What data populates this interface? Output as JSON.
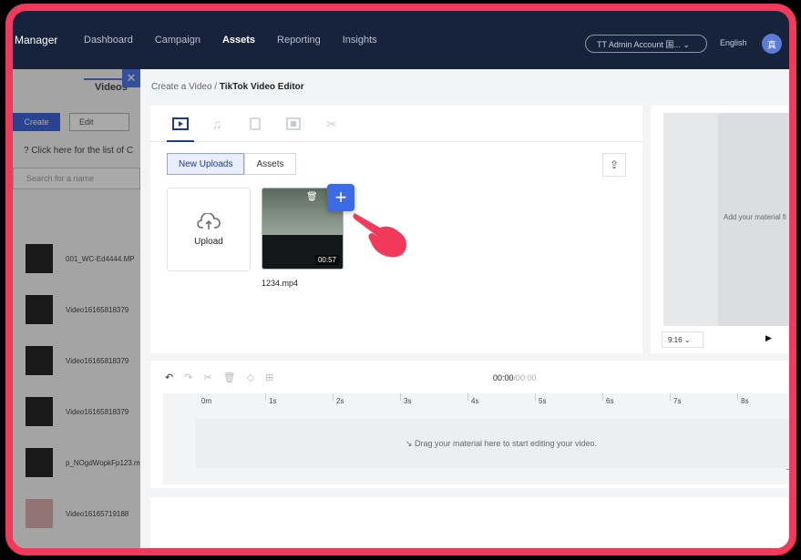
{
  "nav": {
    "brand": "Manager",
    "items": [
      "Dashboard",
      "Campaign",
      "Assets",
      "Reporting",
      "Insights"
    ],
    "active": "Assets",
    "account": "TT Admin Account 国... ⌄",
    "language": "English",
    "avatar": "真"
  },
  "left_panel": {
    "tab": "Videos",
    "close": "✕",
    "create": "Create",
    "edit": "Edit",
    "hint": "? Click here for the list of C",
    "search_placeholder": "Search for a name",
    "items": [
      {
        "name": "001_WC-Ed4444.MP"
      },
      {
        "name": "Video16165818379"
      },
      {
        "name": "Video16165818379"
      },
      {
        "name": "Video16165818379"
      },
      {
        "name": "p_NOgdWopkFp123.m"
      },
      {
        "name": "Video16165719188"
      }
    ]
  },
  "editor": {
    "breadcrumb_parent": "Create a Video",
    "breadcrumb_sep": " / ",
    "breadcrumb_current": "TikTok Video Editor",
    "tab_icons": [
      "video-icon",
      "music-icon",
      "text-icon",
      "sticker-icon",
      "effect-icon"
    ],
    "segments": [
      "New Uploads",
      "Assets"
    ],
    "active_segment": "New Uploads",
    "upload_label": "Upload",
    "video": {
      "filename": "1234.mp4",
      "duration": "00:57"
    },
    "add_label": "+"
  },
  "preview": {
    "placeholder": "Add your material fi",
    "ratio": "9:16",
    "ratio_arrow": "⌄",
    "play": "▶"
  },
  "timeline": {
    "tools": [
      "↶",
      "↷",
      "✂",
      "🗑",
      "◇",
      "⊞"
    ],
    "timecode_current": "00:00",
    "timecode_total": "/00:00",
    "ticks": [
      "0m",
      "1s",
      "2s",
      "3s",
      "4s",
      "5s",
      "6s",
      "7s",
      "8s"
    ],
    "drop_hint": "↘  Drag your material here to start editing your video.",
    "zoom_out": "—"
  },
  "colors": {
    "accent": "#3d6be6",
    "frame": "#f0395b",
    "nav_bg": "#17233a"
  }
}
